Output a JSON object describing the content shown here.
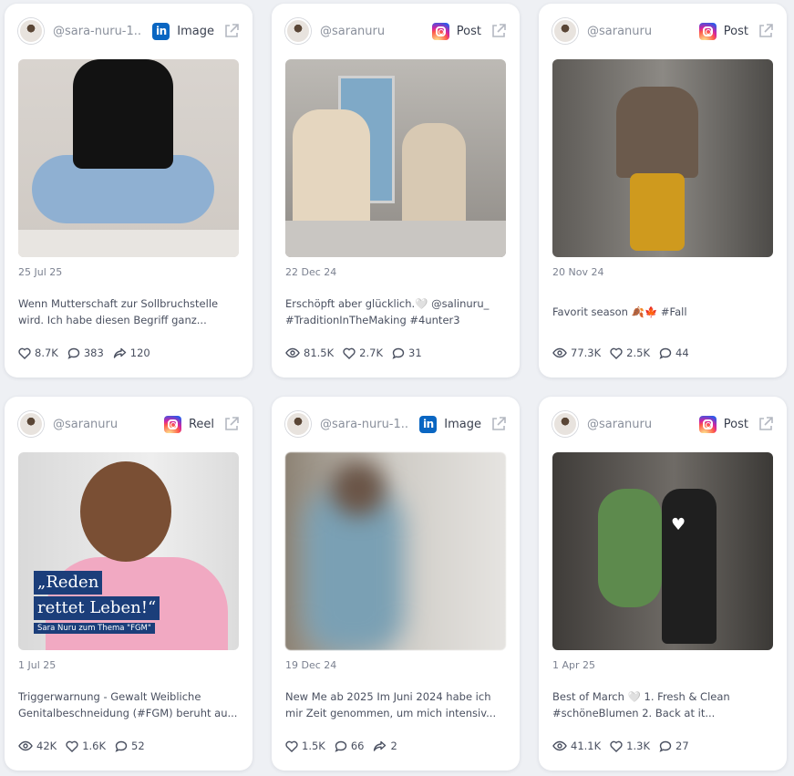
{
  "cards": [
    {
      "handle": "@sara-nuru-1...",
      "platform": "linkedin",
      "type_label": "Image",
      "date": "25 Jul 25",
      "caption_lines": [
        "Wenn Mutterschaft zur Sollbruchstelle",
        "wird. Ich habe diesen Begriff ganz..."
      ],
      "stats": [
        {
          "icon": "heart-icon",
          "value": "8.7K"
        },
        {
          "icon": "comment-icon",
          "value": "383"
        },
        {
          "icon": "share-icon",
          "value": "120"
        }
      ]
    },
    {
      "handle": "@saranuru",
      "platform": "instagram",
      "type_label": "Post",
      "date": "22 Dec 24",
      "caption_lines": [
        "Erschöpft aber glücklich.🤍 @salinuru_",
        "#TraditionInTheMaking #4unter3"
      ],
      "stats": [
        {
          "icon": "eye-icon",
          "value": "81.5K"
        },
        {
          "icon": "heart-icon",
          "value": "2.7K"
        },
        {
          "icon": "comment-icon",
          "value": "31"
        }
      ]
    },
    {
      "handle": "@saranuru",
      "platform": "instagram",
      "type_label": "Post",
      "date": "20 Nov 24",
      "caption_lines": [
        "Favorit season 🍂🍁 #Fall"
      ],
      "stats": [
        {
          "icon": "eye-icon",
          "value": "77.3K"
        },
        {
          "icon": "heart-icon",
          "value": "2.5K"
        },
        {
          "icon": "comment-icon",
          "value": "44"
        }
      ]
    },
    {
      "handle": "@saranuru",
      "platform": "instagram",
      "type_label": "Reel",
      "date": "1 Jul 25",
      "caption_lines": [
        "Triggerwarnung - Gewalt Weibliche",
        "Genitalbeschneidung (#FGM) beruht au..."
      ],
      "overlay": {
        "quote_line1": "„Reden",
        "quote_line2": "rettet Leben!“",
        "sub": "Sara Nuru zum Thema \"FGM\""
      },
      "stats": [
        {
          "icon": "eye-icon",
          "value": "42K"
        },
        {
          "icon": "heart-icon",
          "value": "1.6K"
        },
        {
          "icon": "comment-icon",
          "value": "52"
        }
      ]
    },
    {
      "handle": "@sara-nuru-1...",
      "platform": "linkedin",
      "type_label": "Image",
      "date": "19 Dec 24",
      "caption_lines": [
        "New Me ab 2025 Im Juni 2024 habe ich",
        "mir Zeit genommen, um mich intensiv..."
      ],
      "stats": [
        {
          "icon": "heart-icon",
          "value": "1.5K"
        },
        {
          "icon": "comment-icon",
          "value": "66"
        },
        {
          "icon": "share-icon",
          "value": "2"
        }
      ]
    },
    {
      "handle": "@saranuru",
      "platform": "instagram",
      "type_label": "Post",
      "date": "1 Apr 25",
      "caption_lines": [
        "Best of March 🤍 1. Fresh & Clean",
        "#schöneBlumen 2. Back at it..."
      ],
      "stats": [
        {
          "icon": "eye-icon",
          "value": "41.1K"
        },
        {
          "icon": "heart-icon",
          "value": "1.3K"
        },
        {
          "icon": "comment-icon",
          "value": "27"
        }
      ]
    }
  ],
  "icons_text": {
    "linkedin_glyph": "in"
  }
}
